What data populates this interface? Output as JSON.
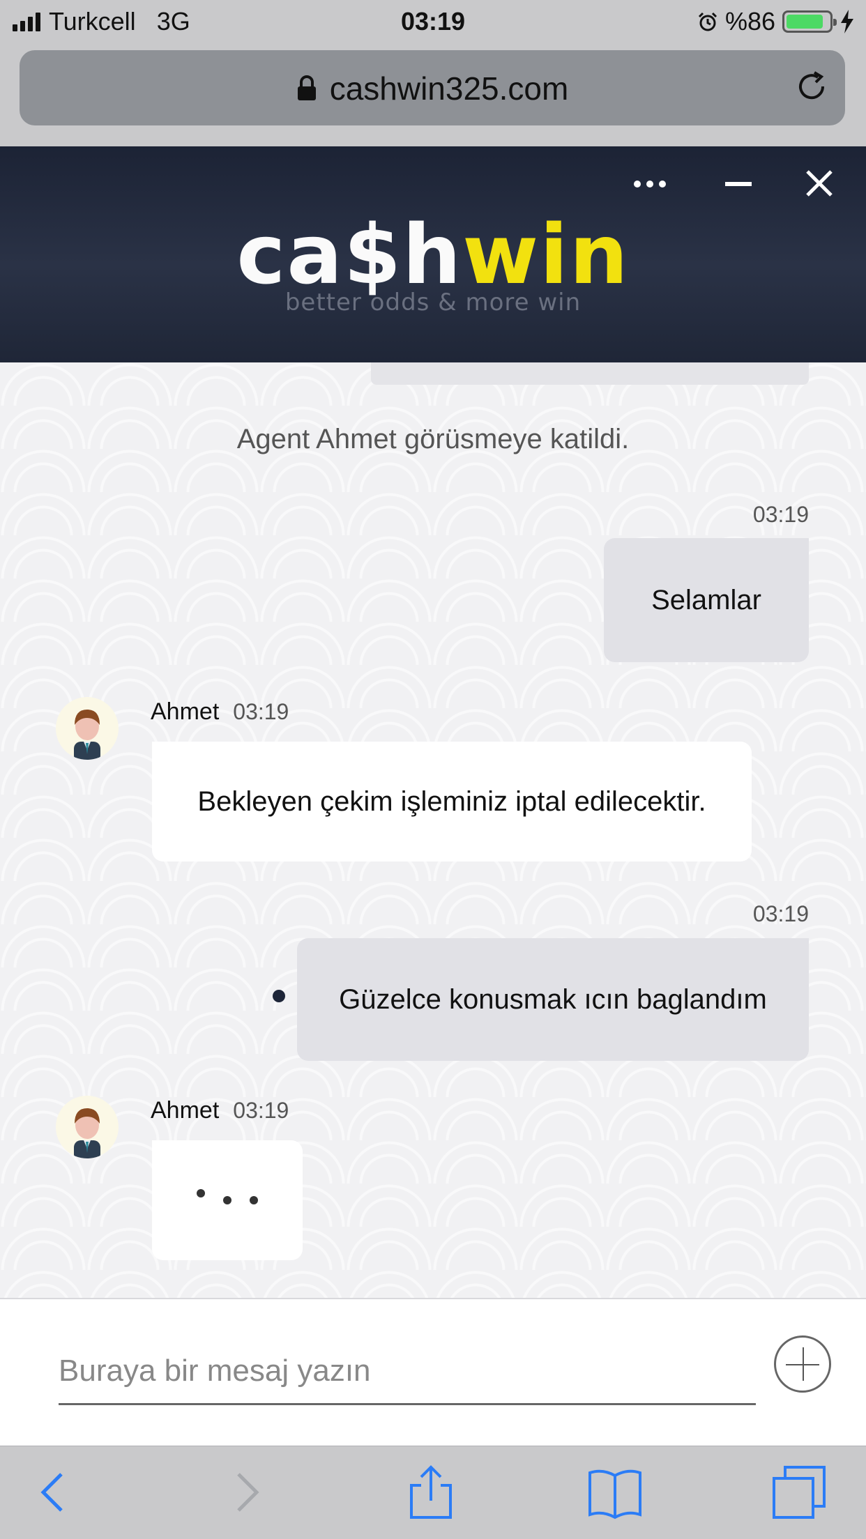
{
  "status_bar": {
    "carrier": "Turkcell",
    "network": "3G",
    "time": "03:19",
    "battery_text": "%86",
    "battery_level": 0.86,
    "icons": [
      "signal-icon",
      "alarm-icon",
      "battery-icon",
      "charging-icon"
    ]
  },
  "browser": {
    "url": "cashwin325.com",
    "icons": [
      "lock-icon",
      "reload-icon"
    ]
  },
  "chat_header": {
    "logo_white": "ca$h",
    "logo_yellow": "win",
    "tagline": "better odds & more win",
    "icons": [
      "more-icon",
      "minimize-icon",
      "close-icon"
    ]
  },
  "messages": {
    "system_note": "Agent Ahmet görüsmeye katildi.",
    "items": [
      {
        "direction": "out",
        "time": "03:19",
        "text": "Selamlar"
      },
      {
        "direction": "in",
        "sender": "Ahmet",
        "time": "03:19",
        "text": "Bekleyen çekim işleminiz iptal edilecektir."
      },
      {
        "direction": "out",
        "time": "03:19",
        "text": "Güzelce konusmak ıcın baglandım"
      },
      {
        "direction": "in",
        "sender": "Ahmet",
        "time": "03:19",
        "typing": true
      }
    ]
  },
  "composer": {
    "placeholder": "Buraya bir mesaj yazın",
    "icons": [
      "add-icon"
    ]
  },
  "toolbar": {
    "icons": [
      "back-icon",
      "forward-icon",
      "share-icon",
      "bookmarks-icon",
      "tabs-icon"
    ]
  },
  "colors": {
    "header_bg": "#1c2335",
    "brand_yellow": "#f2e10f",
    "outgoing_bubble": "#e1e1e6",
    "incoming_bubble": "#ffffff",
    "ios_blue": "#2b7cf6",
    "battery_green": "#4cd964"
  }
}
